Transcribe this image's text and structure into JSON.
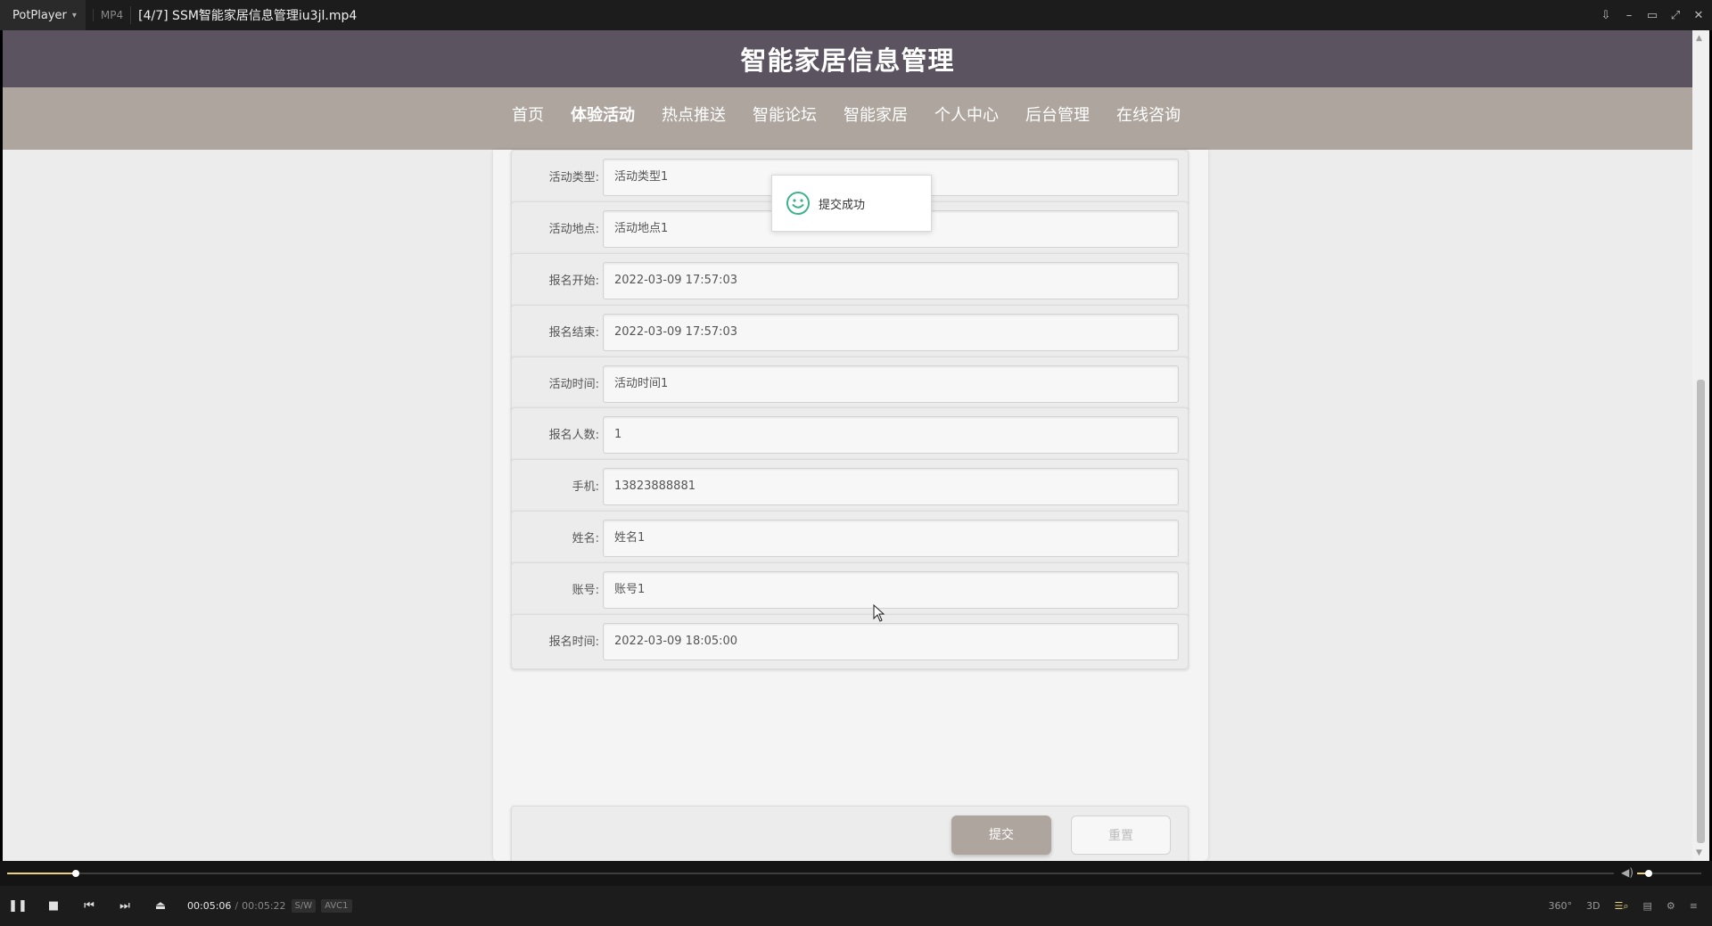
{
  "player": {
    "brand": "PotPlayer",
    "format": "MP4",
    "file_title": "[4/7] SSM智能家居信息管理iu3jl.mp4",
    "time_current": "00:05:06",
    "time_separator": "/",
    "time_total": "00:05:22",
    "badge_sw": "S/W",
    "badge_codec": "AVC1",
    "progress_fraction": 0.043,
    "volume_fraction": 0.18,
    "right_controls": {
      "vr": "360°",
      "three_d": "3D"
    }
  },
  "site": {
    "title": "智能家居信息管理",
    "nav": [
      {
        "label": "首页",
        "active": false
      },
      {
        "label": "体验活动",
        "active": true
      },
      {
        "label": "热点推送",
        "active": false
      },
      {
        "label": "智能论坛",
        "active": false
      },
      {
        "label": "智能家居",
        "active": false
      },
      {
        "label": "个人中心",
        "active": false
      },
      {
        "label": "后台管理",
        "active": false
      },
      {
        "label": "在线咨询",
        "active": false
      }
    ]
  },
  "form": {
    "fields": [
      {
        "label": "活动类型:",
        "value": "活动类型1"
      },
      {
        "label": "活动地点:",
        "value": "活动地点1"
      },
      {
        "label": "报名开始:",
        "value": "2022-03-09 17:57:03"
      },
      {
        "label": "报名结束:",
        "value": "2022-03-09 17:57:03"
      },
      {
        "label": "活动时间:",
        "value": "活动时间1"
      },
      {
        "label": "报名人数:",
        "value": "1"
      },
      {
        "label": "手机:",
        "value": "13823888881"
      },
      {
        "label": "姓名:",
        "value": "姓名1"
      },
      {
        "label": "账号:",
        "value": "账号1"
      },
      {
        "label": "报名时间:",
        "value": "2022-03-09 18:05:00"
      }
    ],
    "submit_label": "提交",
    "reset_label": "重置"
  },
  "toast": {
    "message": "提交成功",
    "icon": "smile-icon",
    "color": "#3db389"
  },
  "colors": {
    "header_bg": "#5b5360",
    "nav_bg": "#aea59e",
    "accent": "#e8d37a"
  }
}
